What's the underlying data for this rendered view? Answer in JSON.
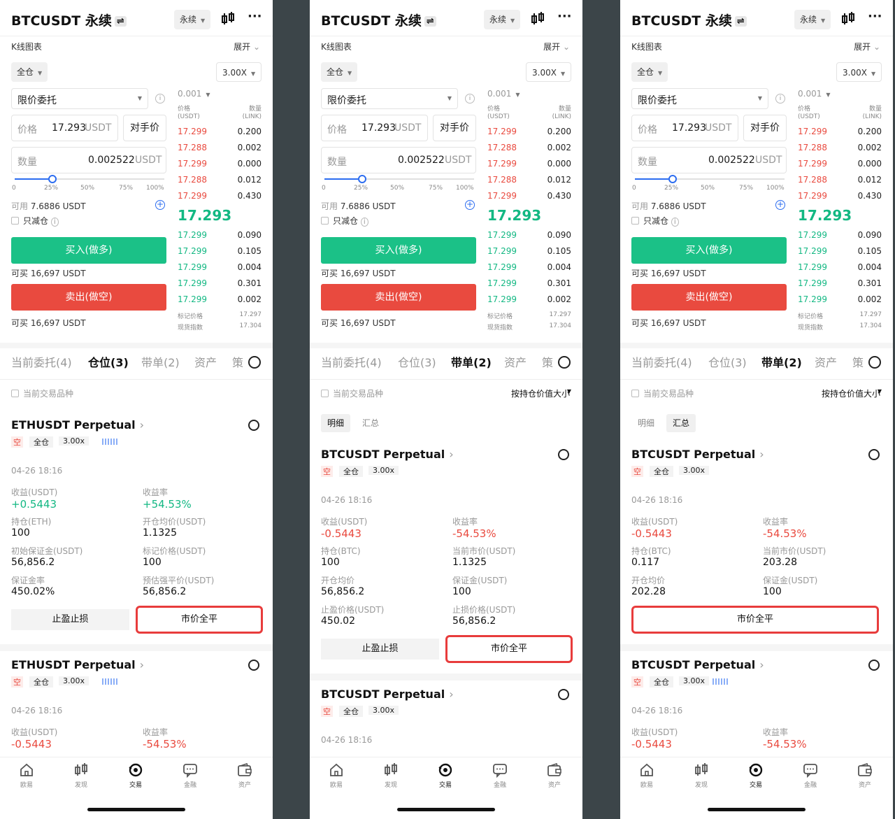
{
  "header": {
    "title": "BTCUSDT 永续",
    "swap": "⇌",
    "mode": "永续",
    "kline": "K线图表",
    "expand": "展开"
  },
  "order": {
    "margin_mode": "全仓",
    "leverage": "3.00X",
    "order_type": "限价委托",
    "price_label": "价格",
    "price_value": "17.293",
    "unit": "USDT",
    "counter": "对手价",
    "qty_label": "数量",
    "qty_value": "0.002522",
    "slider_marks": [
      "0",
      "25%",
      "50%",
      "75%",
      "100%"
    ],
    "slider_fraction": 0.25,
    "avail_label": "可用",
    "avail_value": "7.6886 USDT",
    "reduce_only": "只减仓",
    "buy": "买入(做多)",
    "buy_can": "可买 16,697 USDT",
    "sell": "卖出(做空)",
    "sell_can": "可买 16,697 USDT"
  },
  "orderbook": {
    "tick": "0.001",
    "col_price": "价格",
    "col_price_unit": "(USDT)",
    "col_qty": "数量",
    "col_qty_unit": "(LINK)",
    "asks": [
      [
        "17.299",
        "0.200"
      ],
      [
        "17.288",
        "0.002"
      ],
      [
        "17.299",
        "0.000"
      ],
      [
        "17.288",
        "0.012"
      ],
      [
        "17.299",
        "0.430"
      ]
    ],
    "last": "17.293",
    "bids": [
      [
        "17.299",
        "0.090"
      ],
      [
        "17.299",
        "0.105"
      ],
      [
        "17.299",
        "0.004"
      ],
      [
        "17.299",
        "0.301"
      ],
      [
        "17.299",
        "0.002"
      ]
    ],
    "mark_label": "标记价格",
    "mark_value": "17.297",
    "index_label": "现货指数",
    "index_value": "17.304"
  },
  "tabs": [
    "当前委托(4)",
    "仓位(3)",
    "带单(2)",
    "资产",
    "策"
  ],
  "current_pair": "当前交易品种",
  "sort_label": "按持仓价值大小",
  "subtabs": [
    "明细",
    "汇总"
  ],
  "panels": [
    {
      "active_tab": 1,
      "cards": [
        {
          "name": "ETHUSDT Perpetual",
          "side": "空",
          "mode": "全仓",
          "lev": "3.00x",
          "time": "04-26 18:16",
          "rows": [
            [
              {
                "l": "收益(USDT)",
                "v": "+0.5443"
              },
              {
                "l": "收益率",
                "v": "+54.53%"
              }
            ],
            [
              {
                "l": "持仓(ETH)",
                "v": "100"
              },
              {
                "l": "开仓均价(USDT)",
                "v": "1.1325"
              }
            ],
            [
              {
                "l": "初始保证金(USDT)",
                "v": "56,856.2"
              },
              {
                "l": "标记价格(USDT)",
                "v": "100"
              }
            ],
            [
              {
                "l": "保证金率",
                "v": "450.02%"
              },
              {
                "l": "预估强平价(USDT)",
                "v": "56,856.2"
              }
            ]
          ],
          "btn1": "止盈止损",
          "btn2": "市价全平"
        },
        {
          "name": "ETHUSDT Perpetual",
          "side": "空",
          "mode": "全仓",
          "lev": "3.00x",
          "time": "04-26 18:16",
          "rows": [
            [
              {
                "l": "收益(USDT)",
                "v": "-0.5443"
              },
              {
                "l": "收益率",
                "v": "-54.53%"
              }
            ]
          ]
        }
      ]
    },
    {
      "active_tab": 2,
      "cards": [
        {
          "name": "BTCUSDT Perpetual",
          "side": "空",
          "mode": "全仓",
          "lev": "3.00x",
          "time": "04-26 18:16",
          "rows": [
            [
              {
                "l": "收益(USDT)",
                "v": "-0.5443"
              },
              {
                "l": "收益率",
                "v": "-54.53%"
              }
            ],
            [
              {
                "l": "持仓(BTC)",
                "v": "100"
              },
              {
                "l": "当前市价(USDT)",
                "v": "1.1325"
              }
            ],
            [
              {
                "l": "开仓均价",
                "v": "56,856.2"
              },
              {
                "l": "保证金(USDT)",
                "v": "100"
              }
            ],
            [
              {
                "l": "止盈价格(USDT)",
                "v": "450.02"
              },
              {
                "l": "止损价格(USDT)",
                "v": "56,856.2"
              }
            ]
          ],
          "btn1": "止盈止损",
          "btn2": "市价全平"
        },
        {
          "name": "BTCUSDT Perpetual",
          "side": "空",
          "mode": "全仓",
          "lev": "3.00x",
          "time": "04-26 18:16"
        }
      ]
    },
    {
      "active_tab": 2,
      "cards": [
        {
          "name": "BTCUSDT Perpetual",
          "side": "空",
          "mode": "全仓",
          "lev": "3.00x",
          "time": "04-26 18:16",
          "rows": [
            [
              {
                "l": "收益(USDT)",
                "v": "-0.5443"
              },
              {
                "l": "收益率",
                "v": "-54.53%"
              }
            ],
            [
              {
                "l": "持仓(BTC)",
                "v": "0.117"
              },
              {
                "l": "当前市价(USDT)",
                "v": "203.28"
              }
            ],
            [
              {
                "l": "开仓均价",
                "v": "202.28"
              },
              {
                "l": "保证金(USDT)",
                "v": "100"
              }
            ]
          ],
          "btn2": "市价全平"
        },
        {
          "name": "BTCUSDT Perpetual",
          "side": "空",
          "mode": "全仓",
          "lev": "3.00x",
          "time": "04-26 18:16",
          "rows": [
            [
              {
                "l": "收益(USDT)",
                "v": "-0.5443"
              },
              {
                "l": "收益率",
                "v": "-54.53%"
              }
            ]
          ]
        }
      ]
    }
  ],
  "nav": [
    "欧易",
    "发现",
    "交易",
    "金融",
    "资产"
  ],
  "colors": {
    "green": "#13b883",
    "red": "#e94a3f",
    "highlight": "#e83c3c"
  }
}
